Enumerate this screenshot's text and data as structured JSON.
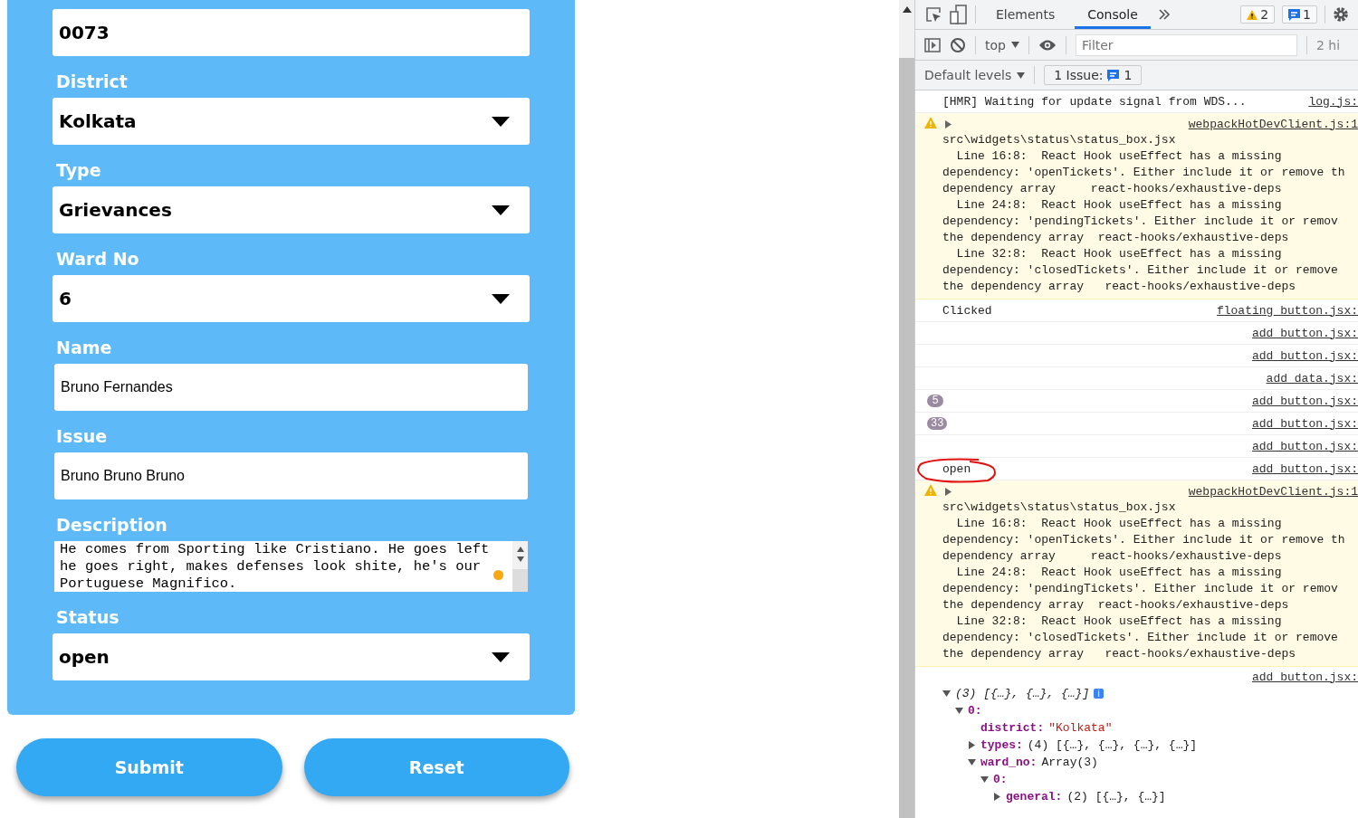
{
  "form": {
    "fields": [
      {
        "kind": "bold-input",
        "value": "0073"
      },
      {
        "kind": "select",
        "label": "District",
        "value": "Kolkata"
      },
      {
        "kind": "select",
        "label": "Type",
        "value": "Grievances"
      },
      {
        "kind": "select",
        "label": "Ward No",
        "value": "6"
      },
      {
        "kind": "input",
        "label": "Name",
        "value": "Bruno Fernandes"
      },
      {
        "kind": "input",
        "label": "Issue",
        "value": "Bruno Bruno Bruno"
      },
      {
        "kind": "textarea",
        "label": "Description",
        "value": "He comes from Sporting like Cristiano. He goes left he goes right, makes defenses look shite, he's our Portuguese Magnifico."
      },
      {
        "kind": "select",
        "label": "Status",
        "value": "open"
      }
    ],
    "buttons": [
      "Submit",
      "Reset"
    ]
  },
  "devtools": {
    "tabs": [
      {
        "label": "Elements",
        "selected": false
      },
      {
        "label": "Console",
        "selected": true
      }
    ],
    "warning_count": "2",
    "message_count": "1",
    "context": "top",
    "filter_placeholder": "Filter",
    "hidden_count": "2 hi",
    "levels": "Default levels",
    "issues_label": "1 Issue:",
    "issues_count": "1",
    "messages": [
      {
        "kind": "log",
        "text": "[HMR] Waiting for update signal from WDS...",
        "source": "log.js:"
      },
      {
        "kind": "warning",
        "expanded": false,
        "source": "webpackHotDevClient.js:1",
        "lines": [
          "src\\widgets\\status\\status_box.jsx",
          "  Line 16:8:  React Hook useEffect has a missing",
          "dependency: 'openTickets'. Either include it or remove th",
          "dependency array     react-hooks/exhaustive-deps",
          "  Line 24:8:  React Hook useEffect has a missing",
          "dependency: 'pendingTickets'. Either include it or remov",
          "the dependency array  react-hooks/exhaustive-deps",
          "  Line 32:8:  React Hook useEffect has a missing",
          "dependency: 'closedTickets'. Either include it or remove",
          "the dependency array   react-hooks/exhaustive-deps"
        ]
      },
      {
        "kind": "log",
        "text": "Clicked",
        "source": "floating_button.jsx:"
      },
      {
        "kind": "log",
        "source": "add_button.jsx:"
      },
      {
        "kind": "log",
        "source": "add_button.jsx:"
      },
      {
        "kind": "log",
        "source": "add_data.jsx:"
      },
      {
        "kind": "count",
        "count": "5",
        "source": "add_button.jsx:"
      },
      {
        "kind": "count",
        "count": "33",
        "source": "add_button.jsx:"
      },
      {
        "kind": "log",
        "source": "add_button.jsx:"
      },
      {
        "kind": "log",
        "text": "open",
        "circled": true,
        "source": "add_button.jsx:"
      },
      {
        "kind": "warning",
        "expanded": false,
        "source": "webpackHotDevClient.js:1",
        "lines": [
          "src\\widgets\\status\\status_box.jsx",
          "  Line 16:8:  React Hook useEffect has a missing",
          "dependency: 'openTickets'. Either include it or remove th",
          "dependency array     react-hooks/exhaustive-deps",
          "  Line 24:8:  React Hook useEffect has a missing",
          "dependency: 'pendingTickets'. Either include it or remov",
          "the dependency array  react-hooks/exhaustive-deps",
          "  Line 32:8:  React Hook useEffect has a missing",
          "dependency: 'closedTickets'. Either include it or remove",
          "the dependency array   react-hooks/exhaustive-deps"
        ]
      },
      {
        "kind": "object",
        "source": "add_button.jsx:",
        "tree": [
          {
            "label": "(3) [{…}, {…}, {…}]",
            "expanded": true,
            "info": "i",
            "children": [
              {
                "key": "0:",
                "expanded": true,
                "children": [
                  {
                    "key": "district:",
                    "value": "\"Kolkata\"",
                    "kind": "string"
                  },
                  {
                    "key": "types:",
                    "value": "(4) [{…}, {…}, {…}, {…}]",
                    "expanded": false
                  },
                  {
                    "key": "ward_no:",
                    "value": "Array(3)",
                    "expanded": true,
                    "children": [
                      {
                        "key": "0:",
                        "expanded": true,
                        "children": [
                          {
                            "key": "general:",
                            "value": "(2) [{…}, {…}]",
                            "expanded": false
                          }
                        ]
                      }
                    ]
                  }
                ]
              }
            ]
          }
        ]
      }
    ]
  }
}
